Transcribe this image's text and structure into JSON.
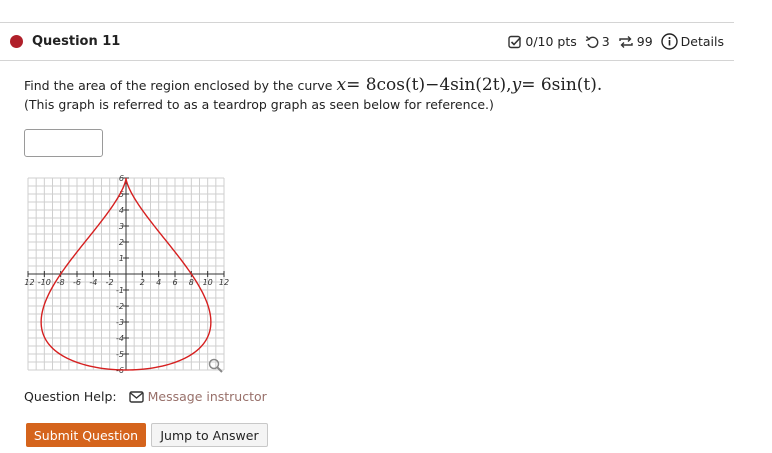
{
  "question": {
    "title": "Question 11",
    "status_color": "#b0202a",
    "points": "0/10 pts",
    "attempts": "3",
    "retries": "99",
    "details_label": "Details"
  },
  "prompt": {
    "text_before": "Find the area of the region enclosed by the curve",
    "equation": {
      "x_var": "x",
      "x_rhs": "= 8cos(t)−4sin(2t),",
      "y_var": "y",
      "y_rhs": "= 6sin(t)",
      "end": "."
    },
    "note": "(This graph is referred to as a teardrop graph as seen below for reference.)"
  },
  "answer_input": {
    "value": ""
  },
  "graph": {
    "curve_color": "#d62020",
    "x_tick_labels": [
      "-12",
      "-10",
      "-8",
      "-6",
      "-4",
      "-2",
      "2",
      "4",
      "6",
      "8",
      "10",
      "12"
    ],
    "y_tick_labels": [
      "6",
      "5",
      "4",
      "3",
      "2",
      "1",
      "-1",
      "-2",
      "-3",
      "-4",
      "-5",
      "-6"
    ],
    "zoom_icon": "magnifier-icon"
  },
  "chart_data": {
    "type": "line",
    "title": "",
    "xlabel": "",
    "ylabel": "",
    "xlim": [
      -12,
      12
    ],
    "ylim": [
      -6,
      6
    ],
    "grid": true,
    "series": [
      {
        "parametric_x": "8cos(t)-4sin(2t)",
        "parametric_y": "6sin(t)",
        "t_range": [
          0,
          6.2832
        ]
      }
    ]
  },
  "help": {
    "label": "Question Help:",
    "message_link": "Message instructor",
    "link_color": "#98706a"
  },
  "buttons": {
    "submit": "Submit Question",
    "jump": "Jump to Answer",
    "submit_color": "#d5641c"
  }
}
